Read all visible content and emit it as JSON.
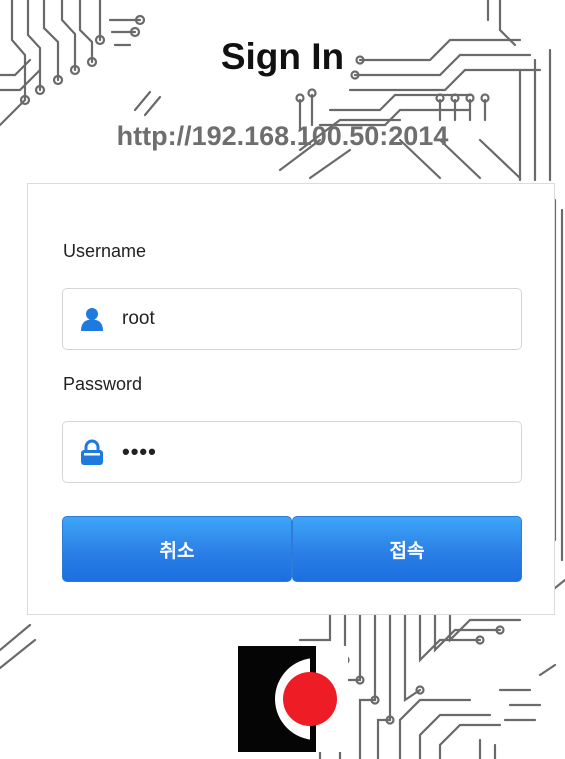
{
  "page": {
    "title": "Sign In",
    "url": "http://192.168.100.50:2014"
  },
  "form": {
    "username_label": "Username",
    "username_value": "root",
    "password_label": "Password",
    "password_value": "1234"
  },
  "buttons": {
    "cancel_label": "취소",
    "connect_label": "접속"
  },
  "colors": {
    "accent": "#2c7fe6",
    "icon": "#1f7ae0",
    "logo_red": "#ee1c25"
  },
  "icons": {
    "username": "user-icon",
    "password": "lock-icon"
  }
}
